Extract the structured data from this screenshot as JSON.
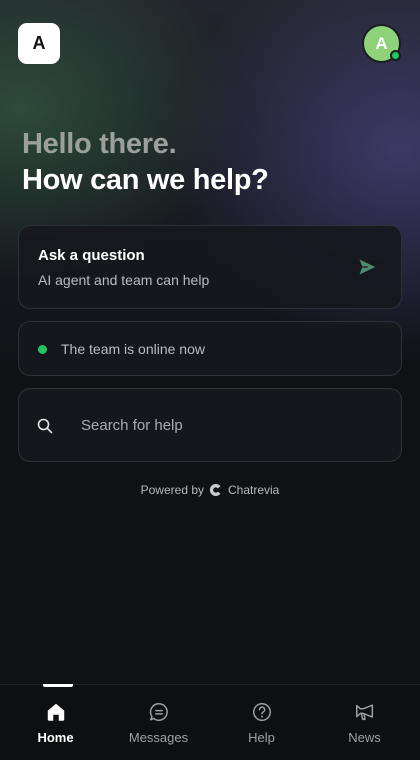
{
  "header": {
    "logo_letter": "A",
    "avatar_letter": "A"
  },
  "greeting": {
    "line1": "Hello there.",
    "line2": "How can we help?"
  },
  "ask_card": {
    "title": "Ask a question",
    "subtitle": "AI agent and team can help",
    "icon": "send-icon"
  },
  "status_card": {
    "text": "The team is online now",
    "status_color": "#22c55e"
  },
  "search": {
    "placeholder": "Search for help",
    "icon": "search-icon"
  },
  "footer": {
    "powered_by": "Powered by",
    "brand": "Chatrevia"
  },
  "tabs": [
    {
      "label": "Home",
      "icon": "home-icon",
      "active": true
    },
    {
      "label": "Messages",
      "icon": "messages-icon",
      "active": false
    },
    {
      "label": "Help",
      "icon": "help-icon",
      "active": false
    },
    {
      "label": "News",
      "icon": "megaphone-icon",
      "active": false
    }
  ],
  "colors": {
    "accent_green": "#22c55e",
    "avatar_bg": "#8ed37a",
    "send_icon": "#4e8a6e"
  }
}
